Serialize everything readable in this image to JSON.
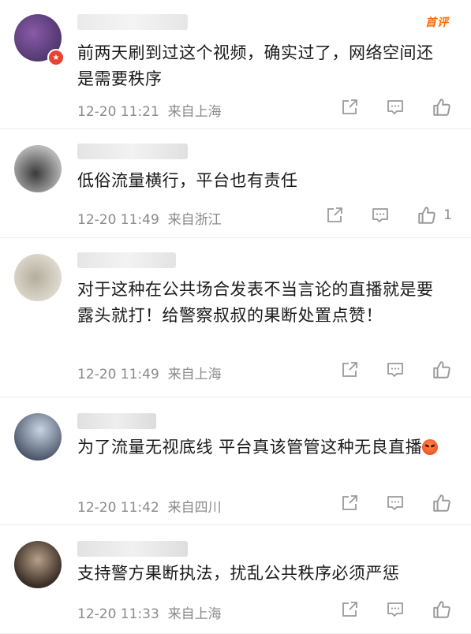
{
  "comments": [
    {
      "text": "前两天刷到过这个视频，确实过了，网络空间还是需要秩序",
      "time": "12-20 11:21",
      "location": "来自上海",
      "badge": "首评",
      "likes": "",
      "avatar_colors": [
        "#6a3a8a",
        "#3a2a5a"
      ]
    },
    {
      "text": "低俗流量横行，平台也有责任",
      "time": "12-20 11:49",
      "location": "来自浙江",
      "likes": "1",
      "avatar_colors": [
        "#7a7a7a",
        "#3a3a3a"
      ]
    },
    {
      "text": "对于这种在公共场合发表不当言论的直播就是要露头就打！给警察叔叔的果断处置点赞！",
      "time": "12-20 11:49",
      "location": "来自上海",
      "likes": "",
      "avatar_colors": [
        "#cfcabb",
        "#a9a495"
      ]
    },
    {
      "text": "为了流量无视底线 平台真该管管这种无良直播",
      "time": "12-20 11:42",
      "location": "来自四川",
      "likes": "",
      "avatar_colors": [
        "#9aa7b8",
        "#4a5568"
      ]
    },
    {
      "text": "支持警方果断执法，扰乱公共秩序必须严惩",
      "time": "12-20 11:33",
      "location": "来自上海",
      "likes": "",
      "avatar_colors": [
        "#8a7a6a",
        "#3a2e26"
      ]
    }
  ],
  "icons": {
    "share": "share-icon",
    "comment": "comment-icon",
    "like": "thumbs-up-icon"
  },
  "colors": {
    "meta_text": "#8a8a8a",
    "badge": "#ff6a00",
    "icon": "#9a9a9a"
  }
}
